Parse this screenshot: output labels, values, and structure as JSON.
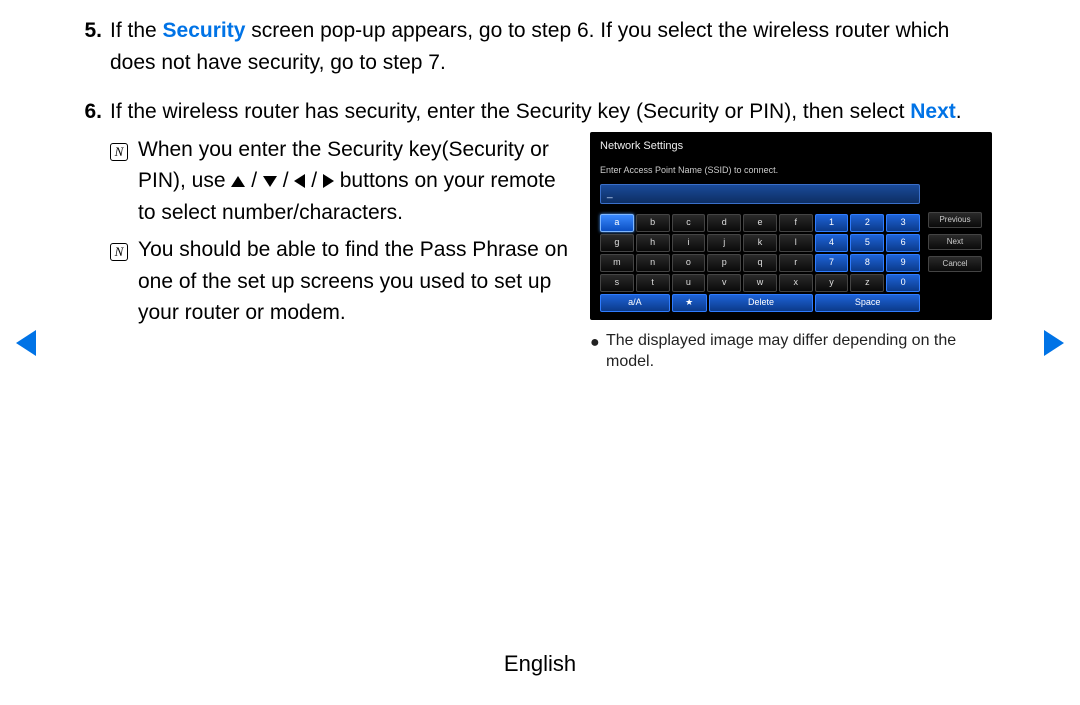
{
  "steps": {
    "s5": {
      "num": "5.",
      "pre": "If the ",
      "hl": "Security",
      "post": " screen pop-up appears, go to step 6. If you select the wireless router which does not have security, go to step 7."
    },
    "s6": {
      "num": "6.",
      "pre": "If the wireless router has security, enter the Security key (Security or PIN), then select ",
      "hl": "Next",
      "post": "."
    }
  },
  "notes": {
    "n1": {
      "pre": "When you enter the Security key(Security or PIN), use ",
      "mid": " buttons on your remote to select number/characters."
    },
    "n2": "You should be able to find the Pass Phrase on one of the set up screens you used to set up your router or modem."
  },
  "tv": {
    "title": "Network Settings",
    "prompt": "Enter Access Point Name (SSID) to connect.",
    "input_value": "_",
    "rows": [
      [
        "a",
        "b",
        "c",
        "d",
        "e",
        "f",
        "1",
        "2",
        "3"
      ],
      [
        "g",
        "h",
        "i",
        "j",
        "k",
        "l",
        "4",
        "5",
        "6"
      ],
      [
        "m",
        "n",
        "o",
        "p",
        "q",
        "r",
        "7",
        "8",
        "9"
      ],
      [
        "s",
        "t",
        "u",
        "v",
        "w",
        "x",
        "y",
        "z",
        "0"
      ]
    ],
    "bottom": {
      "case": "a/A",
      "star": "★",
      "delete": "Delete",
      "space": "Space"
    },
    "side": {
      "prev": "Previous",
      "next": "Next",
      "cancel": "Cancel"
    }
  },
  "caption": "The displayed image may differ depending on the model.",
  "footer": "English",
  "slash": " / "
}
